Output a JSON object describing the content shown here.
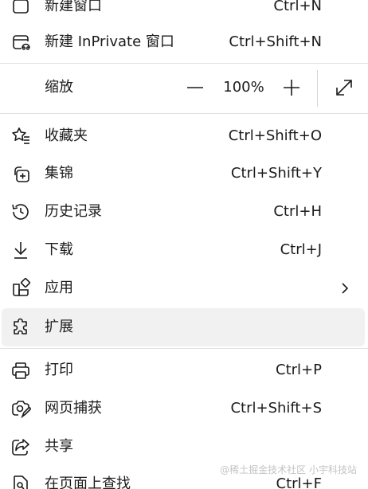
{
  "menu": {
    "new_window": {
      "label": "新建窗口",
      "shortcut": "Ctrl+N",
      "icon": "new-window-icon"
    },
    "new_inprivate": {
      "label": "新建 InPrivate 窗口",
      "shortcut": "Ctrl+Shift+N",
      "icon": "inprivate-icon"
    },
    "zoom": {
      "label": "缩放",
      "value": "100%",
      "minus_icon": "minus-icon",
      "plus_icon": "plus-icon",
      "fullscreen_icon": "fullscreen-icon"
    },
    "favorites": {
      "label": "收藏夹",
      "shortcut": "Ctrl+Shift+O",
      "icon": "favorites-star-icon"
    },
    "collections": {
      "label": "集锦",
      "shortcut": "Ctrl+Shift+Y",
      "icon": "collections-icon"
    },
    "history": {
      "label": "历史记录",
      "shortcut": "Ctrl+H",
      "icon": "history-icon"
    },
    "downloads": {
      "label": "下载",
      "shortcut": "Ctrl+J",
      "icon": "download-icon"
    },
    "apps": {
      "label": "应用",
      "icon": "apps-icon",
      "submenu_icon": "chevron-right-icon"
    },
    "extensions": {
      "label": "扩展",
      "icon": "extensions-puzzle-icon"
    },
    "print": {
      "label": "打印",
      "shortcut": "Ctrl+P",
      "icon": "printer-icon"
    },
    "web_capture": {
      "label": "网页捕获",
      "shortcut": "Ctrl+Shift+S",
      "icon": "web-capture-icon"
    },
    "share": {
      "label": "共享",
      "icon": "share-icon"
    },
    "find_on_page": {
      "label": "在页面上查找",
      "shortcut": "Ctrl+F",
      "icon": "find-icon"
    }
  },
  "watermark": {
    "text": "@稀土掘金技术社区 小宇科技站"
  },
  "colors": {
    "text": "#1b1b1b",
    "hover_bg": "#f1f1f1",
    "divider": "#e1e1e1"
  }
}
